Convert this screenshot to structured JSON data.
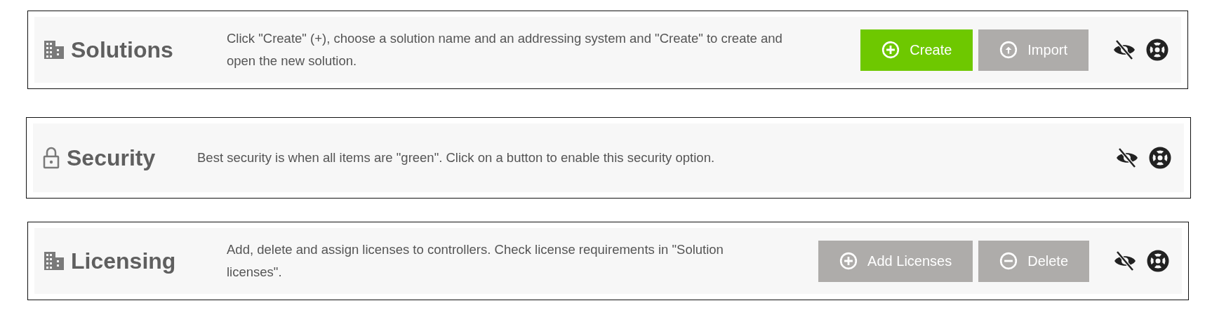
{
  "panels": [
    {
      "kind": "building",
      "title": "Solutions",
      "description": "Click \"Create\" (+), choose a solution name and an addressing system and \"Create\" to create and open the new solution.",
      "buttons": [
        {
          "label": "Create",
          "kind": "add",
          "disabled": false
        },
        {
          "label": "Import",
          "kind": "import",
          "disabled": true
        }
      ]
    },
    {
      "kind": "lock",
      "title": "Security",
      "description": "Best security is when all items are \"green\". Click on a button to enable this security option."
    },
    {
      "kind": "building",
      "title": "Licensing",
      "description": "Add, delete and assign licenses to controllers. Check license requirements in \"Solution licenses\".",
      "buttons": [
        {
          "label": "Add Licenses",
          "kind": "add",
          "disabled": true
        },
        {
          "label": "Delete",
          "kind": "delete",
          "disabled": true
        }
      ]
    }
  ]
}
